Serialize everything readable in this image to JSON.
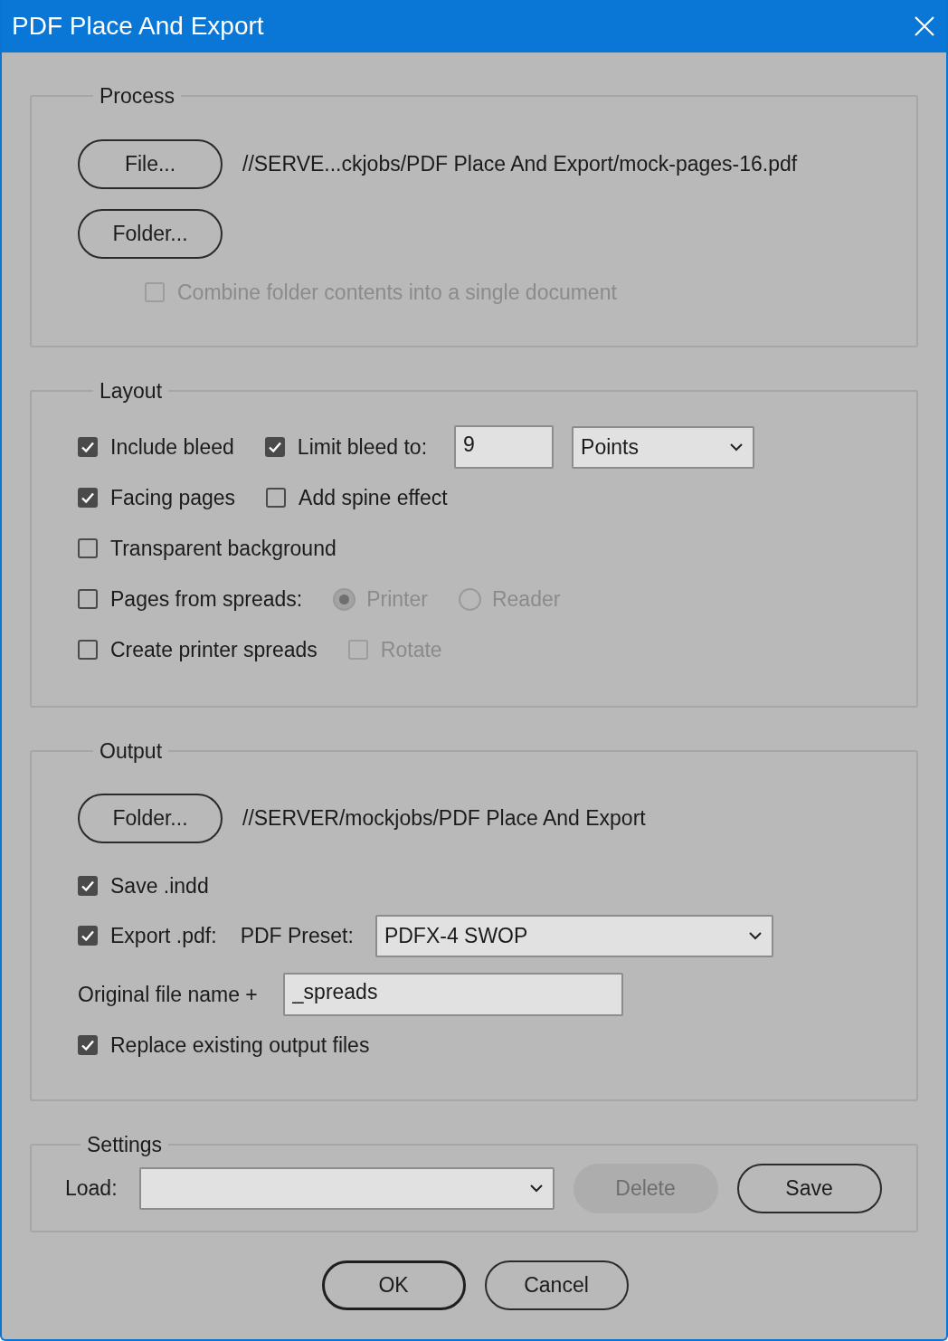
{
  "window": {
    "title": "PDF Place And Export"
  },
  "process": {
    "legend": "Process",
    "file_button": "File...",
    "file_path": "//SERVE...ckjobs/PDF Place And Export/mock-pages-16.pdf",
    "folder_button": "Folder...",
    "combine": {
      "label": "Combine folder contents into a single document",
      "checked": false,
      "disabled": true
    }
  },
  "layout": {
    "legend": "Layout",
    "rows": [
      {
        "items": [
          {
            "kind": "checkbox",
            "label": "Include bleed",
            "checked": true,
            "disabled": false
          },
          {
            "kind": "checkbox",
            "label": "Limit bleed to:",
            "checked": true,
            "disabled": false
          },
          {
            "kind": "field",
            "value": "9"
          },
          {
            "kind": "dropdown",
            "value": "Points"
          }
        ]
      },
      {
        "items": [
          {
            "kind": "checkbox",
            "label": "Facing pages",
            "checked": true,
            "disabled": false
          },
          {
            "kind": "checkbox",
            "label": "Add spine effect",
            "checked": false,
            "disabled": false
          }
        ]
      },
      {
        "items": [
          {
            "kind": "checkbox",
            "label": "Transparent background",
            "checked": false,
            "disabled": false
          }
        ]
      },
      {
        "items": [
          {
            "kind": "checkbox",
            "label": "Pages from spreads:",
            "checked": false,
            "disabled": false
          },
          {
            "kind": "radio",
            "label": "Printer",
            "selected": true,
            "disabled": true
          },
          {
            "kind": "radio",
            "label": "Reader",
            "selected": false,
            "disabled": true
          }
        ]
      },
      {
        "items": [
          {
            "kind": "checkbox",
            "label": "Create printer spreads",
            "checked": false,
            "disabled": false
          },
          {
            "kind": "checkbox",
            "label": "Rotate",
            "checked": false,
            "disabled": true
          }
        ]
      }
    ]
  },
  "output": {
    "legend": "Output",
    "folder_button": "Folder...",
    "folder_path": "//SERVER/mockjobs/PDF Place And Export",
    "save_indd": {
      "label": "Save .indd",
      "checked": true
    },
    "export_pdf": {
      "label": "Export .pdf:",
      "checked": true
    },
    "preset_label": "PDF Preset:",
    "preset": "PDFX-4 SWOP",
    "filename_label": "Original file name +",
    "filename_suffix": "_spreads",
    "replace": {
      "label": "Replace existing output files",
      "checked": true
    }
  },
  "settings": {
    "legend": "Settings",
    "load_label": "Load:",
    "delete_button": {
      "label": "Delete",
      "disabled": true
    },
    "save_button": {
      "label": "Save",
      "disabled": false
    }
  },
  "buttons": [
    {
      "label": "OK",
      "default": true
    },
    {
      "label": "Cancel",
      "default": false
    }
  ]
}
